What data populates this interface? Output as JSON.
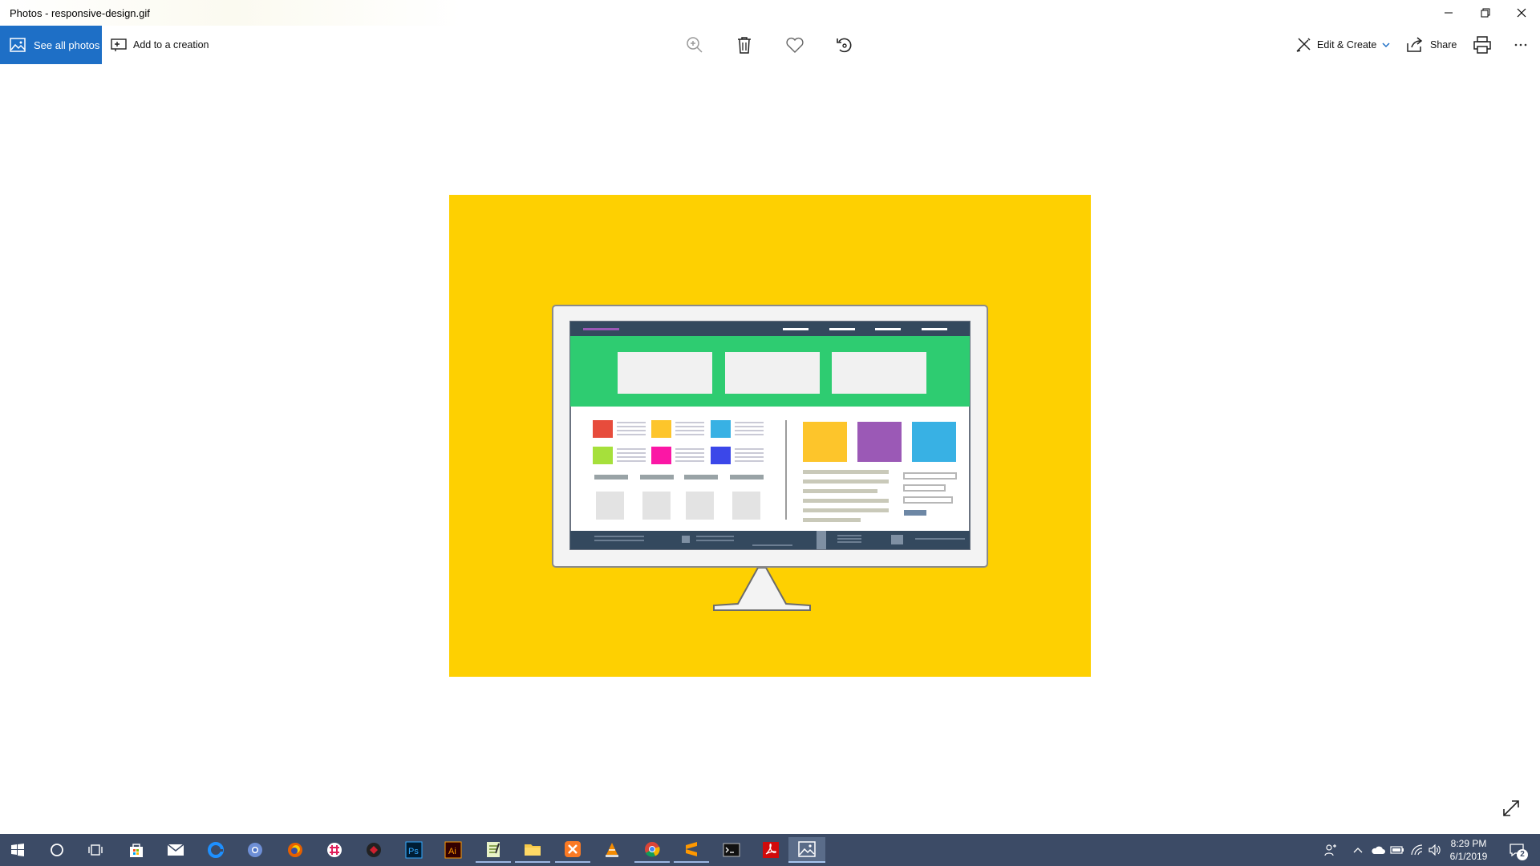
{
  "window": {
    "title": "Photos - responsive-design.gif",
    "minimize_icon": "minimize-icon",
    "restore_icon": "restore-icon",
    "close_icon": "close-icon"
  },
  "toolbar": {
    "see_all_photos": "See all photos",
    "add_to_creation": "Add to a creation",
    "zoom_icon": "zoom-in-icon",
    "delete_icon": "trash-icon",
    "favorite_icon": "heart-icon",
    "rotate_icon": "rotate-icon",
    "edit_create": "Edit & Create",
    "share": "Share",
    "print_icon": "print-icon",
    "more_icon": "more-icon"
  },
  "image": {
    "background": "#fed001",
    "monitor_header_color": "#34495e",
    "hero_color": "#2ecc71",
    "swatches_left": [
      "#e74c3c",
      "#fdc52b",
      "#38b1e4",
      "#a6e03b",
      "#fb17a5",
      "#3b47e9"
    ],
    "swatches_right": [
      "#fdc52b",
      "#9b59b6",
      "#38b1e4"
    ]
  },
  "taskbar": {
    "apps": [
      "start-icon",
      "search-icon",
      "task-view-icon",
      "store-icon",
      "mail-icon",
      "edge-icon",
      "chromium-icon",
      "firefox-icon",
      "slack-icon",
      "antivirus-icon",
      "photoshop-icon",
      "illustrator-icon",
      "notepad-icon",
      "file-explorer-icon",
      "xampp-icon",
      "vlc-icon",
      "chrome-icon",
      "sublime-icon",
      "terminal-icon",
      "acrobat-icon",
      "photos-icon"
    ],
    "time": "8:29 PM",
    "date": "6/1/2019",
    "notification_count": "2"
  }
}
